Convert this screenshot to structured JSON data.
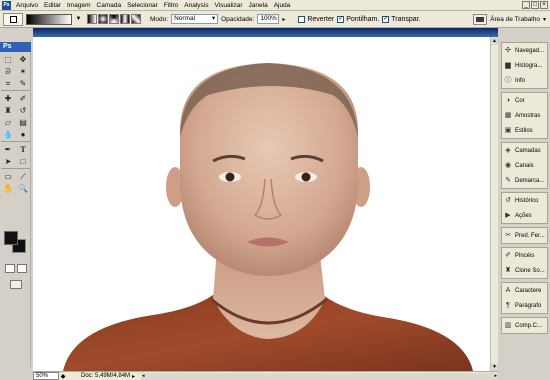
{
  "app": {
    "logo": "Ps"
  },
  "menu": [
    "Arquivo",
    "Editar",
    "Imagem",
    "Camada",
    "Selecionar",
    "Filtro",
    "Analysis",
    "Visualizar",
    "Janela",
    "Ajuda"
  ],
  "window_controls": [
    "_",
    "□",
    "×"
  ],
  "options_bar": {
    "mode_label": "Modo:",
    "mode_value": "Normal",
    "opacity_label": "Opacidade:",
    "opacity_value": "100%",
    "reverse_label": "Reverter",
    "dither_label": "Pontilham.",
    "transparency_label": "Transpar.",
    "reverse_checked": false,
    "dither_checked": true,
    "transparency_checked": true,
    "workspace_label": "Área de Trabalho"
  },
  "toolbox": {
    "badge": "Ps",
    "tools": [
      "marquee",
      "move",
      "lasso",
      "magic-wand",
      "crop",
      "slice",
      "healing",
      "brush",
      "stamp",
      "history-brush",
      "eraser",
      "gradient",
      "blur",
      "dodge",
      "pen",
      "type",
      "path-select",
      "shape",
      "notes",
      "eyedropper",
      "hand",
      "zoom"
    ],
    "foreground_color": "#111111",
    "background_color": "#111111"
  },
  "document": {
    "zoom": "50%",
    "info": "Doc: 5,49M/4,84M"
  },
  "panels": [
    [
      {
        "label": "Navegad...",
        "icon": "navigator-icon"
      },
      {
        "label": "Histogra...",
        "icon": "histogram-icon"
      },
      {
        "label": "Info",
        "icon": "info-icon"
      }
    ],
    [
      {
        "label": "Cor",
        "icon": "color-icon"
      },
      {
        "label": "Amostras",
        "icon": "swatches-icon"
      },
      {
        "label": "Estilos",
        "icon": "styles-icon"
      }
    ],
    [
      {
        "label": "Camadas",
        "icon": "layers-icon"
      },
      {
        "label": "Canais",
        "icon": "channels-icon"
      },
      {
        "label": "Demarca...",
        "icon": "paths-icon"
      }
    ],
    [
      {
        "label": "Histórico",
        "icon": "history-icon"
      },
      {
        "label": "Ações",
        "icon": "actions-icon"
      }
    ],
    [
      {
        "label": "Pred. Fer...",
        "icon": "tool-presets-icon"
      }
    ],
    [
      {
        "label": "Pincéis",
        "icon": "brushes-icon"
      },
      {
        "label": "Clone So...",
        "icon": "clone-source-icon"
      }
    ],
    [
      {
        "label": "Caractere",
        "icon": "character-icon"
      },
      {
        "label": "Parágrafo",
        "icon": "paragraph-icon"
      }
    ],
    [
      {
        "label": "Comp.C...",
        "icon": "layer-comps-icon"
      }
    ]
  ]
}
